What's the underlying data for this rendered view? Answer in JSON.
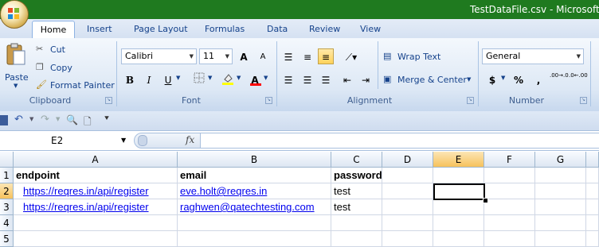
{
  "window": {
    "title": "TestDataFile.csv - Microsoft Exc"
  },
  "tabs": [
    "Home",
    "Insert",
    "Page Layout",
    "Formulas",
    "Data",
    "Review",
    "View"
  ],
  "ribbon": {
    "clipboard": {
      "paste": "Paste",
      "cut": "Cut",
      "copy": "Copy",
      "format_painter": "Format Painter",
      "label": "Clipboard"
    },
    "font": {
      "name": "Calibri",
      "size": "11",
      "bold": "B",
      "italic": "I",
      "underline": "U",
      "grow": "A",
      "shrink": "A",
      "label": "Font",
      "fill_color": "#ffff00",
      "font_color": "#ff0000"
    },
    "alignment": {
      "wrap_text": "Wrap Text",
      "merge_center": "Merge & Center",
      "label": "Alignment"
    },
    "number": {
      "format": "General",
      "currency": "$",
      "percent": "%",
      "comma": ",",
      "inc_decimal": ".00→.0",
      "dec_decimal": ".0←.00",
      "label": "Number"
    }
  },
  "formula_bar": {
    "name_box": "E2",
    "fx": "fx",
    "value": ""
  },
  "sheet": {
    "columns": [
      "A",
      "B",
      "C",
      "D",
      "E",
      "F",
      "G"
    ],
    "selected_column": "E",
    "rows": [
      "1",
      "2",
      "3",
      "4",
      "5"
    ],
    "selected_row": "2",
    "cells": {
      "A1": "endpoint",
      "B1": "email",
      "C1": "password",
      "A2": "https://reqres.in/api/register",
      "B2": "eve.holt@reqres.in",
      "C2": "test",
      "A3": "https://reqres.in/api/register",
      "B3": "raghwen@qatechtesting.com",
      "C3": "test"
    }
  }
}
